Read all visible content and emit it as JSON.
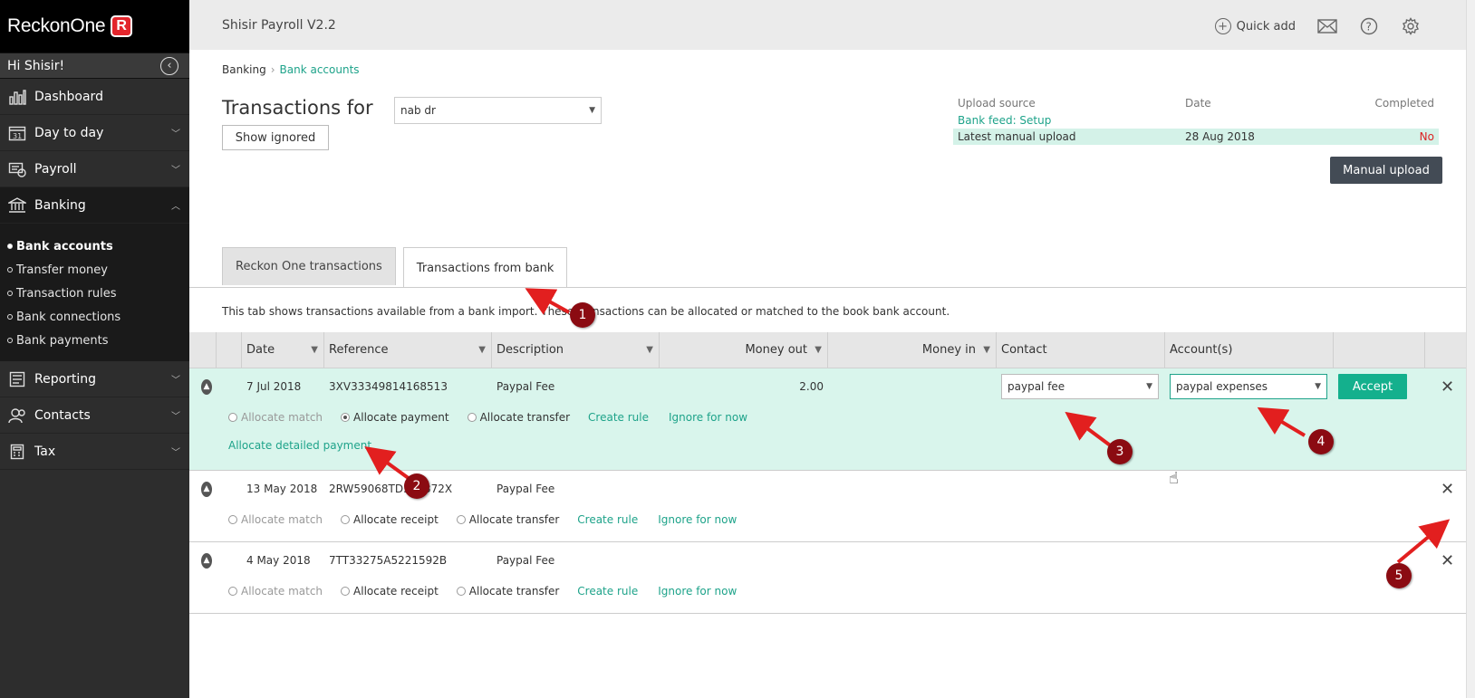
{
  "sidebar": {
    "logo_text": "ReckonOne",
    "logo_badge": "R",
    "greeting": "Hi Shisir!",
    "nav": [
      {
        "label": "Dashboard"
      },
      {
        "label": "Day to day"
      },
      {
        "label": "Payroll"
      },
      {
        "label": "Banking"
      },
      {
        "label": "Reporting"
      },
      {
        "label": "Contacts"
      },
      {
        "label": "Tax"
      }
    ],
    "banking_sub": [
      {
        "label": "Bank accounts"
      },
      {
        "label": "Transfer money"
      },
      {
        "label": "Transaction rules"
      },
      {
        "label": "Bank connections"
      },
      {
        "label": "Bank payments"
      }
    ]
  },
  "header": {
    "app_title": "Shisir Payroll V2.2",
    "quick_add": "Quick add"
  },
  "breadcrumb": {
    "root": "Banking",
    "current": "Bank accounts"
  },
  "page": {
    "title": "Transactions for",
    "account_selected": "nab dr",
    "show_ignored": "Show ignored",
    "manual_upload": "Manual upload"
  },
  "upload_table": {
    "headers": {
      "source": "Upload source",
      "date": "Date",
      "completed": "Completed"
    },
    "rows": [
      {
        "source": "Bank feed: Setup",
        "date": "",
        "completed": ""
      },
      {
        "source": "Latest manual upload",
        "date": "28 Aug 2018",
        "completed": "No"
      }
    ]
  },
  "tabs": [
    {
      "label": "Reckon One transactions"
    },
    {
      "label": "Transactions from bank"
    }
  ],
  "info_text": "This tab shows transactions available from a bank import. These transactions can be allocated or matched to the book bank account.",
  "grid": {
    "headers": {
      "date": "Date",
      "reference": "Reference",
      "description": "Description",
      "money_out": "Money out",
      "money_in": "Money in",
      "contact": "Contact",
      "accounts": "Account(s)"
    },
    "rows": [
      {
        "date": "7 Jul 2018",
        "reference": "3XV33349814168513",
        "description": "Paypal Fee",
        "money_out": "2.00",
        "money_in": "",
        "contact": "paypal fee",
        "account": "paypal expenses",
        "accept": "Accept",
        "options": {
          "match": "Allocate match",
          "payment": "Allocate payment",
          "transfer": "Allocate transfer",
          "rule": "Create rule",
          "ignore": "Ignore for now",
          "detailed": "Allocate detailed payment"
        }
      },
      {
        "date": "13 May 2018",
        "reference": "2RW59068TD333372X",
        "description": "Paypal Fee",
        "options": {
          "match": "Allocate match",
          "receipt": "Allocate receipt",
          "transfer": "Allocate transfer",
          "rule": "Create rule",
          "ignore": "Ignore for now"
        }
      },
      {
        "date": "4 May 2018",
        "reference": "7TT33275A5221592B",
        "description": "Paypal Fee",
        "options": {
          "match": "Allocate match",
          "receipt": "Allocate receipt",
          "transfer": "Allocate transfer",
          "rule": "Create rule",
          "ignore": "Ignore for now"
        }
      }
    ]
  },
  "annotations": [
    "1",
    "2",
    "3",
    "4",
    "5"
  ],
  "colors": {
    "accent": "#1ea38a",
    "accept": "#14b08d",
    "annotation": "#8b0b12",
    "selected_row": "#d9f5ec"
  }
}
